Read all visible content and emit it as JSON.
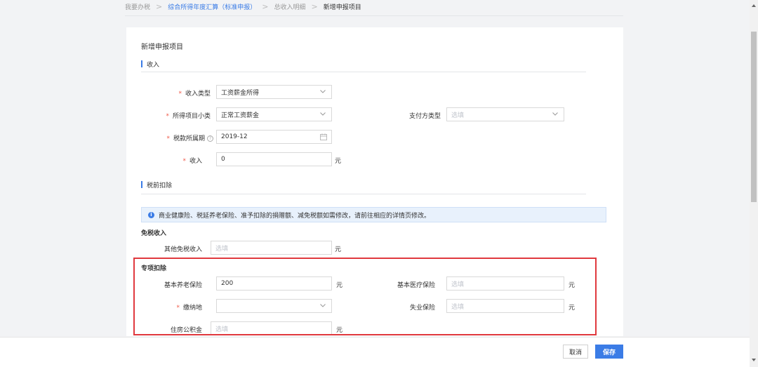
{
  "breadcrumb": {
    "items": [
      "我要办税",
      "综合所得年度汇算（标准申报）",
      "总收入明细",
      "新增申报项目"
    ]
  },
  "page_title": "新增申报项目",
  "sections": {
    "income": "收入",
    "pretax": "税前扣除"
  },
  "income_form": {
    "income_type": {
      "label": "收入类型",
      "value": "工资薪金所得"
    },
    "income_subtype": {
      "label": "所得项目小类",
      "value": "正常工资薪金"
    },
    "payer_type": {
      "label": "支付方类型",
      "placeholder": "选填"
    },
    "tax_period": {
      "label": "税款所属期",
      "help": "?",
      "value": "2019-12"
    },
    "income": {
      "label": "收入",
      "value": "0",
      "unit": "元"
    }
  },
  "notice": {
    "icon": "i",
    "text": "商业健康险、税延养老保险、准予扣除的捐赠额、减免税额如需修改，请前往相应的详情页修改。"
  },
  "tax_exempt": {
    "title": "免税收入",
    "other": {
      "label": "其他免税收入",
      "placeholder": "选填",
      "unit": "元"
    }
  },
  "special_deduction": {
    "title": "专项扣除",
    "pension": {
      "label": "基本养老保险",
      "value": "200",
      "unit": "元"
    },
    "medical": {
      "label": "基本医疗保险",
      "placeholder": "选填",
      "unit": "元"
    },
    "payment_place": {
      "label": "缴纳地",
      "value": ""
    },
    "unemployment": {
      "label": "失业保险",
      "placeholder": "选填",
      "unit": "元"
    },
    "housing_fund": {
      "label": "住房公积金",
      "placeholder": "选填",
      "unit": "元"
    }
  },
  "actions": {
    "cancel": "取消",
    "save": "保存"
  },
  "colors": {
    "accent": "#3b7ce6",
    "required": "#f05a4a",
    "highlight": "#e0393e"
  }
}
